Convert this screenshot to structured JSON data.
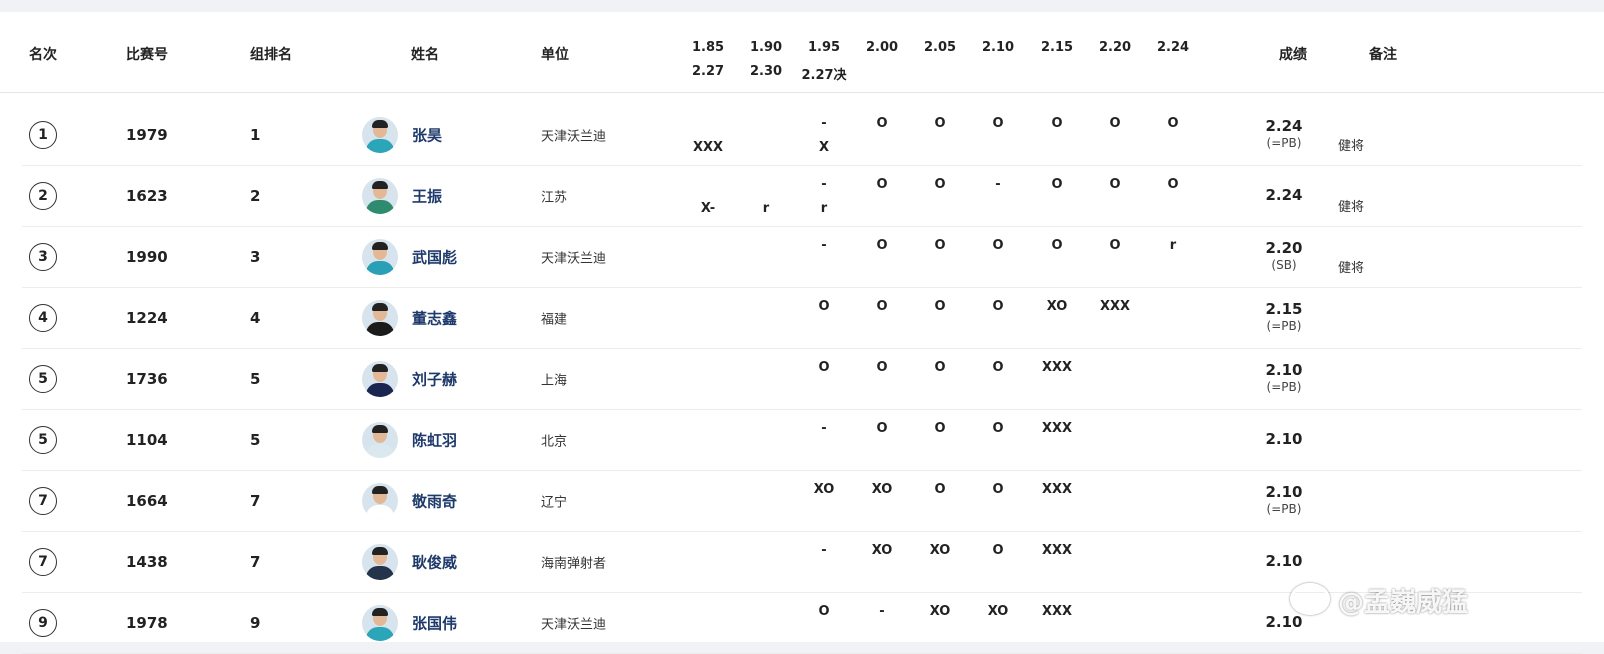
{
  "header": {
    "rank": "名次",
    "bib": "比赛号",
    "group_order": "组排名",
    "name": "姓名",
    "unit": "单位",
    "heights_row1": [
      "1.85",
      "1.90",
      "1.95",
      "2.00",
      "2.05",
      "2.10",
      "2.15",
      "2.20",
      "2.24"
    ],
    "heights_row2": [
      "2.27",
      "2.30",
      "2.27决"
    ],
    "result": "成绩",
    "remark": "备注"
  },
  "rows": [
    {
      "rank": "1",
      "bib": "1979",
      "group": "1",
      "name": "张昊",
      "unit": "天津沃兰迪",
      "line1": [
        "",
        "",
        "-",
        "O",
        "O",
        "O",
        "O",
        "O",
        "O"
      ],
      "line2": [
        "XXX",
        "",
        "X"
      ],
      "mark": "2.24",
      "note": "(=PB)",
      "remark": "健将"
    },
    {
      "rank": "2",
      "bib": "1623",
      "group": "2",
      "name": "王振",
      "unit": "江苏",
      "line1": [
        "",
        "",
        "-",
        "O",
        "O",
        "-",
        "O",
        "O",
        "O"
      ],
      "line2": [
        "X-",
        "r",
        "r"
      ],
      "mark": "2.24",
      "note": "",
      "remark": "健将"
    },
    {
      "rank": "3",
      "bib": "1990",
      "group": "3",
      "name": "武国彪",
      "unit": "天津沃兰迪",
      "line1": [
        "",
        "",
        "-",
        "O",
        "O",
        "O",
        "O",
        "O",
        "r"
      ],
      "line2": [
        "",
        "",
        ""
      ],
      "mark": "2.20",
      "note": "(SB)",
      "remark": "健将"
    },
    {
      "rank": "4",
      "bib": "1224",
      "group": "4",
      "name": "董志鑫",
      "unit": "福建",
      "line1": [
        "",
        "",
        "O",
        "O",
        "O",
        "O",
        "XO",
        "XXX",
        ""
      ],
      "line2": [
        "",
        "",
        ""
      ],
      "mark": "2.15",
      "note": "(=PB)",
      "remark": ""
    },
    {
      "rank": "5",
      "bib": "1736",
      "group": "5",
      "name": "刘子赫",
      "unit": "上海",
      "line1": [
        "",
        "",
        "O",
        "O",
        "O",
        "O",
        "XXX",
        "",
        ""
      ],
      "line2": [
        "",
        "",
        ""
      ],
      "mark": "2.10",
      "note": "(=PB)",
      "remark": ""
    },
    {
      "rank": "5",
      "bib": "1104",
      "group": "5",
      "name": "陈虹羽",
      "unit": "北京",
      "line1": [
        "",
        "",
        "-",
        "O",
        "O",
        "O",
        "XXX",
        "",
        ""
      ],
      "line2": [
        "",
        "",
        ""
      ],
      "mark": "2.10",
      "note": "",
      "remark": ""
    },
    {
      "rank": "7",
      "bib": "1664",
      "group": "7",
      "name": "敬雨奇",
      "unit": "辽宁",
      "line1": [
        "",
        "",
        "XO",
        "XO",
        "O",
        "O",
        "XXX",
        "",
        ""
      ],
      "line2": [
        "",
        "",
        ""
      ],
      "mark": "2.10",
      "note": "(=PB)",
      "remark": ""
    },
    {
      "rank": "7",
      "bib": "1438",
      "group": "7",
      "name": "耿俊威",
      "unit": "海南弹射者",
      "line1": [
        "",
        "",
        "-",
        "XO",
        "XO",
        "O",
        "XXX",
        "",
        ""
      ],
      "line2": [
        "",
        "",
        ""
      ],
      "mark": "2.10",
      "note": "",
      "remark": ""
    },
    {
      "rank": "9",
      "bib": "1978",
      "group": "9",
      "name": "张国伟",
      "unit": "天津沃兰迪",
      "line1": [
        "",
        "",
        "O",
        "-",
        "XO",
        "XO",
        "XXX",
        "",
        ""
      ],
      "line2": [
        "",
        "",
        ""
      ],
      "mark": "2.10",
      "note": "",
      "remark": ""
    }
  ],
  "watermark": "@孟巍威猛",
  "colors": {
    "name_link": "#1e3a6b",
    "avatar_shirts": [
      "#2aa6b8",
      "#2e8b6e",
      "#29a0b6",
      "#1b1b1b",
      "#1a2550",
      "#dce8f0",
      "#ffffff",
      "#24344a",
      "#2aa6b8"
    ]
  }
}
